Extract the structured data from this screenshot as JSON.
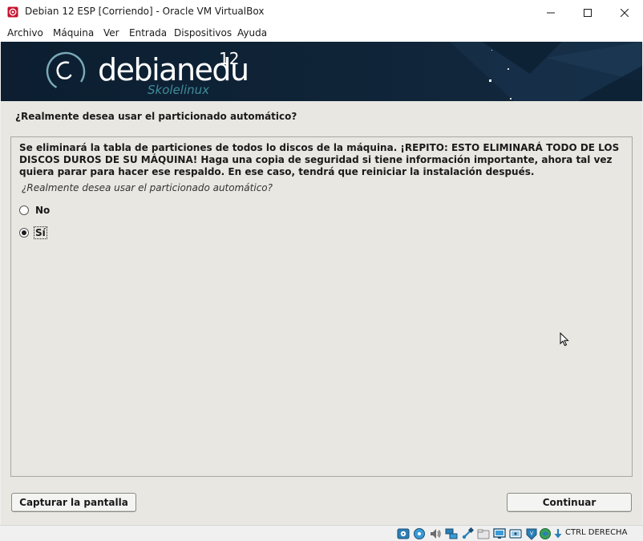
{
  "window": {
    "title": "Debian 12 ESP [Corriendo] - Oracle VM VirtualBox"
  },
  "menu": {
    "items": [
      "Archivo",
      "Máquina",
      "Ver",
      "Entrada",
      "Dispositivos",
      "Ayuda"
    ]
  },
  "banner": {
    "brand": "debianedu",
    "version": "12",
    "subtitle": "Skolelinux"
  },
  "installer": {
    "heading": "¿Realmente desea usar el particionado automático?",
    "description": "Se eliminará la tabla de particiones de todos lo discos de la máquina. ¡REPITO: ESTO ELIMINARÁ TODO DE LOS DISCOS DUROS DE SU MÁQUINA! Haga una copia de seguridad si tiene información importante, ahora tal vez quiera parar para hacer ese respaldo. En ese caso, tendrá que reiniciar la instalación después.",
    "prompt": "¿Realmente desea usar el particionado automático?",
    "options": [
      {
        "label": "No",
        "selected": false
      },
      {
        "label": "Sí",
        "selected": true
      }
    ],
    "capture_button": "Capturar la pantalla",
    "continue_button": "Continuar"
  },
  "statusbar": {
    "host_key": "CTRL DERECHA",
    "icons": [
      "hard-disk-icon",
      "optical-disk-icon",
      "audio-icon",
      "network-icon",
      "usb-icon",
      "shared-folders-icon",
      "display-icon",
      "recording-icon",
      "cpu-virtualization-icon",
      "mouse-integration-icon",
      "keyboard-capture-icon"
    ]
  },
  "colors": {
    "banner_bg": "#0e2236",
    "vm_bg": "#e8e7e2",
    "accent_red": "#c8102e",
    "subtitle_teal": "#3f8c9a"
  }
}
